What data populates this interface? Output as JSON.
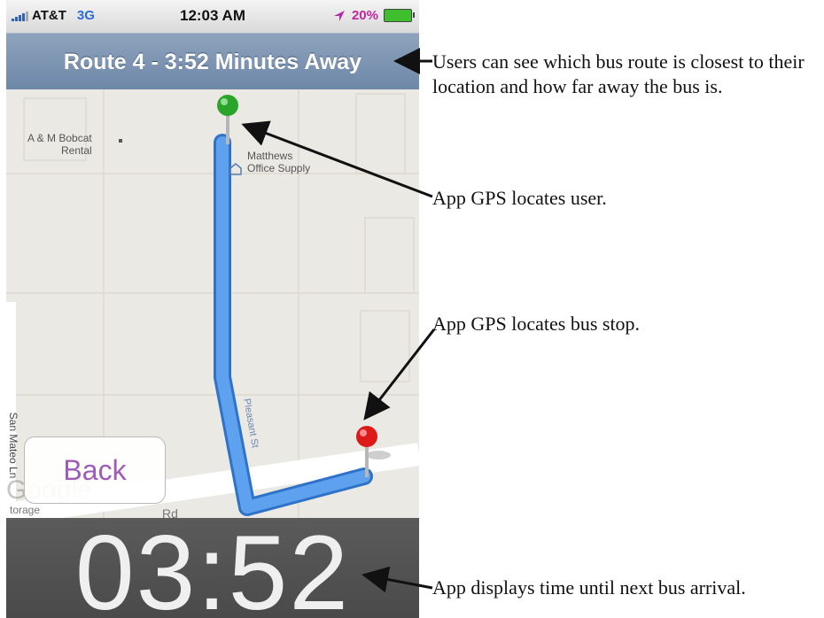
{
  "status_bar": {
    "carrier": "AT&T",
    "network": "3G",
    "time": "12:03 AM",
    "battery": "20%",
    "icons": [
      "signal-icon",
      "location-arrow-icon",
      "battery-charging-icon"
    ]
  },
  "nav": {
    "title": "Route 4 - 3:52 Minutes Away"
  },
  "map": {
    "labels": {
      "rental": "A & M Bobcat\nRental",
      "supply": "Matthews\nOffice Supply",
      "street_left": "San Mateo Ln",
      "street_route": "Pleasant St",
      "road_bottom": "Rd",
      "storage": "torage",
      "watermark": "Google"
    },
    "pins": {
      "user": "green-pin-icon",
      "bus_stop": "red-pin-icon"
    },
    "colors": {
      "route": "#4a90e2",
      "user_pin": "#2aa52a",
      "stop_pin": "#dd1a1a"
    }
  },
  "back_button": {
    "label": "Back"
  },
  "countdown": {
    "value": "03:52"
  },
  "annotations": {
    "route_info": "Users can see which bus route is closest to their location and how far away the bus is.",
    "user_gps": "App GPS locates user.",
    "stop_gps": "App GPS locates bus stop.",
    "time_display": "App displays time until next bus arrival."
  }
}
